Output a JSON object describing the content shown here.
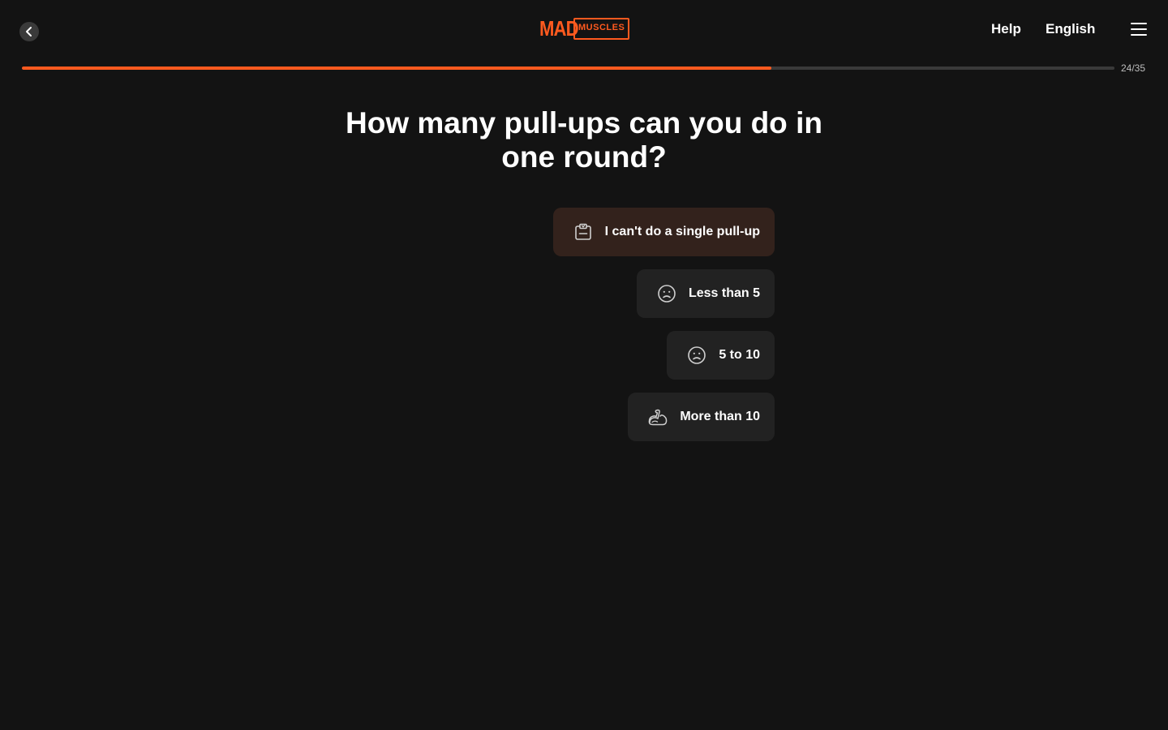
{
  "header": {
    "logo_primary": "MAD",
    "logo_secondary": "MUSCLES",
    "help_label": "Help",
    "language_label": "English",
    "brand_color": "#ff5a1f"
  },
  "progress": {
    "current": 24,
    "total": 35,
    "label": "24/35"
  },
  "question": {
    "title": "How many pull-ups can you do in one round?"
  },
  "options": [
    {
      "label": "I can't do a single pull-up",
      "icon": "clipboard-icon",
      "selected": true
    },
    {
      "label": "Less than 5",
      "icon": "sad-face-icon",
      "selected": false
    },
    {
      "label": "5 to 10",
      "icon": "sad-face-icon",
      "selected": false
    },
    {
      "label": "More than 10",
      "icon": "flexed-bicep-icon",
      "selected": false
    }
  ]
}
